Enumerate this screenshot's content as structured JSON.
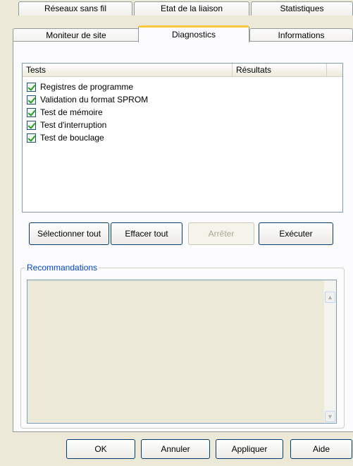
{
  "tabs": {
    "row1": [
      "Réseaux sans fil",
      "Etat de la liaison",
      "Statistiques"
    ],
    "row2": [
      "Moniteur de site",
      "Diagnostics",
      "Informations"
    ],
    "active": "Diagnostics"
  },
  "tests_list": {
    "columns": [
      "Tests",
      "Résultats"
    ],
    "items": [
      {
        "label": "Registres de programme",
        "checked": true
      },
      {
        "label": "Validation du format SPROM",
        "checked": true
      },
      {
        "label": "Test de mémoire",
        "checked": true
      },
      {
        "label": "Test d'interruption",
        "checked": true
      },
      {
        "label": "Test de bouclage",
        "checked": true
      }
    ]
  },
  "actions": {
    "select_all": "Sélectionner tout",
    "clear_all": "Effacer tout",
    "stop": "Arrêter",
    "run": "Exécuter"
  },
  "recommendations": {
    "label": "Recommandations",
    "text": ""
  },
  "dialog_buttons": {
    "ok": "OK",
    "cancel": "Annuler",
    "apply": "Appliquer",
    "help": "Aide"
  },
  "scroll_icons": {
    "up": "scroll-up-icon",
    "down": "scroll-down-icon"
  }
}
